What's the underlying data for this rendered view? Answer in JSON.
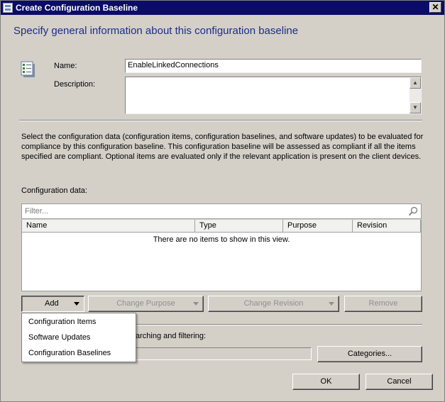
{
  "window": {
    "title": "Create Configuration Baseline",
    "close_glyph": "✕"
  },
  "header": {
    "text": "Specify general information about this configuration baseline"
  },
  "form": {
    "name_label": "Name:",
    "name_value": "EnableLinkedConnections",
    "description_label": "Description:",
    "description_value": ""
  },
  "info_text": "Select the configuration data (configuration items, configuration baselines, and software updates) to be evaluated for compliance by this configuration baseline. This configuration baseline will be assessed as compliant if all the items specified are compliant. Optional items are evaluated only if the relevant application is present on  the client devices.",
  "config_data": {
    "label": "Configuration data:",
    "filter_placeholder": "Filter...",
    "columns": [
      "Name",
      "Type",
      "Purpose",
      "Revision"
    ],
    "empty_message": "There are no items to show in this view."
  },
  "buttons": {
    "add": "Add",
    "change_purpose": "Change Purpose",
    "change_revision": "Change Revision",
    "remove": "Remove",
    "categories": "Categories...",
    "ok": "OK",
    "cancel": "Cancel"
  },
  "add_menu": {
    "items": [
      "Configuration Items",
      "Software Updates",
      "Configuration Baselines"
    ]
  },
  "categories_section": {
    "label_partial": "arching and filtering:"
  },
  "icons": {
    "title": "baseline-icon",
    "form": "configuration-baseline-icon",
    "filter": "search-icon"
  }
}
